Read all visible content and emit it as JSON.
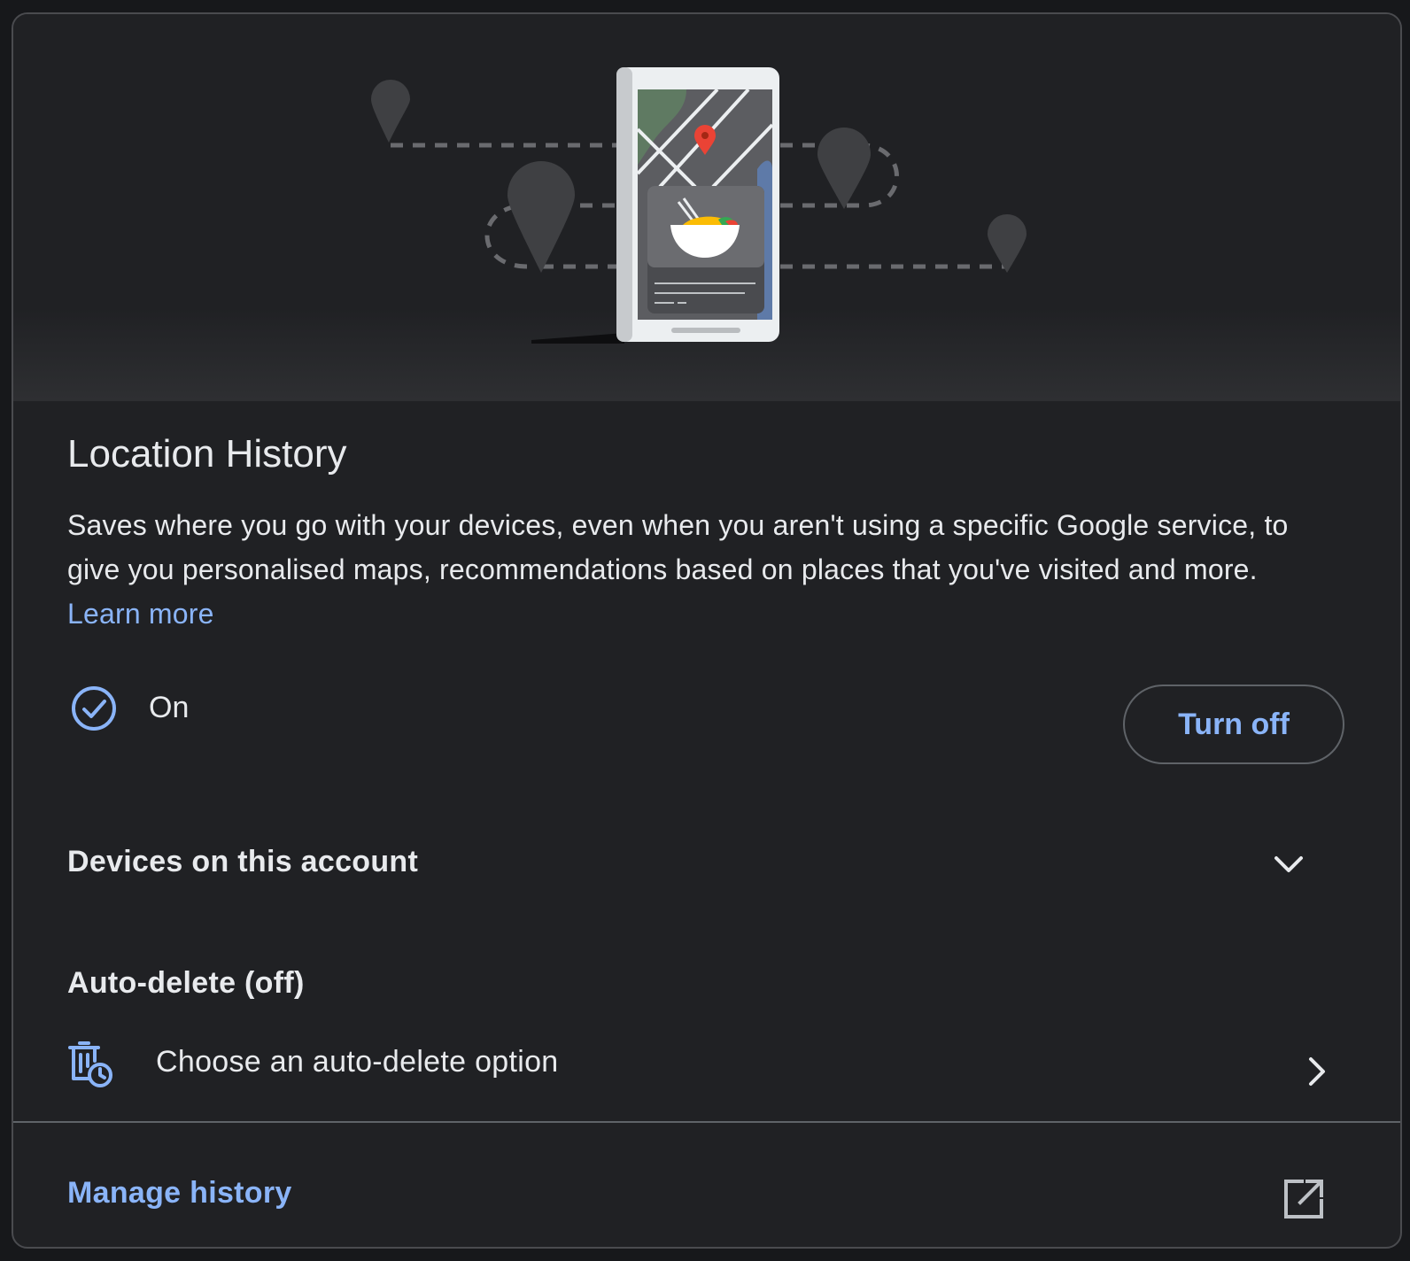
{
  "card": {
    "title": "Location History",
    "description": "Saves where you go with your devices, even when you aren't using a specific Google service, to give you personalised maps, recommendations based on places that you've visited and more.",
    "learn_more": "Learn more"
  },
  "status": {
    "state_label": "On",
    "state_icon": "check-circle-icon",
    "turn_off_label": "Turn off"
  },
  "devices": {
    "label": "Devices on this account",
    "expand_icon": "chevron-down-icon",
    "expanded": false
  },
  "auto_delete": {
    "heading": "Auto-delete (off)",
    "option_label": "Choose an auto-delete option",
    "option_icon": "auto-delete-icon",
    "chevron_icon": "chevron-right-icon"
  },
  "manage": {
    "label": "Manage history",
    "icon": "open-in-new-icon"
  },
  "colors": {
    "background": "#202124",
    "text": "#e8eaed",
    "accent": "#8ab4f8",
    "border": "#5f6368",
    "pin": "#ea4335"
  }
}
